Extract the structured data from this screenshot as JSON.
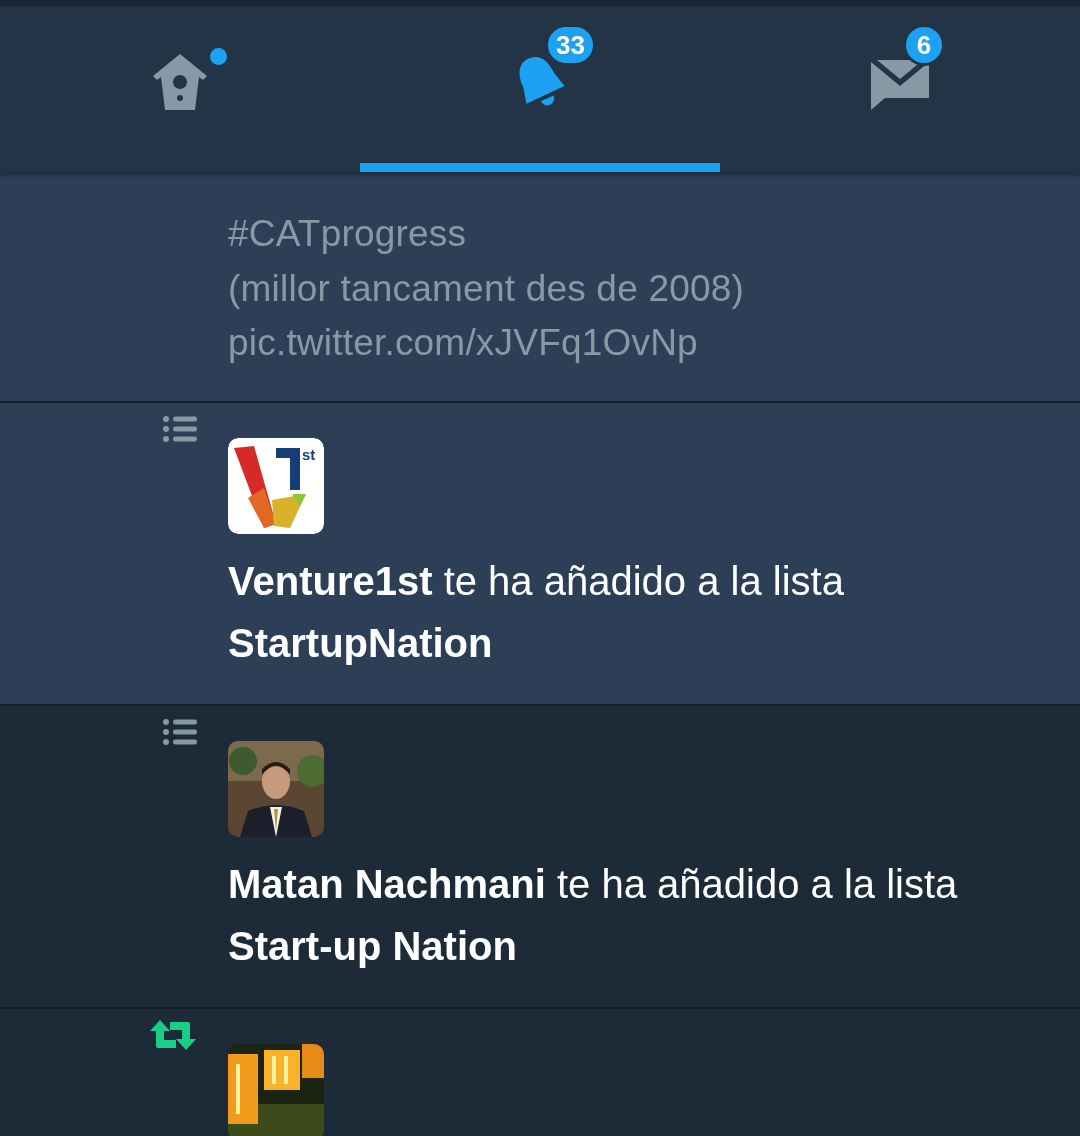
{
  "tabs": [
    {
      "kind": "home",
      "selected": false,
      "dot": true
    },
    {
      "kind": "notifications",
      "selected": true,
      "badge": "33"
    },
    {
      "kind": "messages",
      "selected": false,
      "badge": "6"
    }
  ],
  "notifications": [
    {
      "kind": "tweet",
      "unread": true,
      "text": "#CATprogress\n(millor tancament des de 2008)\npic.twitter.com/xJVFq1OvNp"
    },
    {
      "kind": "list_add",
      "unread": true,
      "avatar": {
        "kind": "logo",
        "logo_text": "st"
      },
      "text": "**Venture1st** te ha añadido a la lista **StartupNation**"
    },
    {
      "kind": "list_add",
      "unread": false,
      "text": "**Matan Nachmani** te ha añadido a la lista **Start-up Nation**"
    },
    {
      "kind": "retweet",
      "unread": false
    }
  ]
}
